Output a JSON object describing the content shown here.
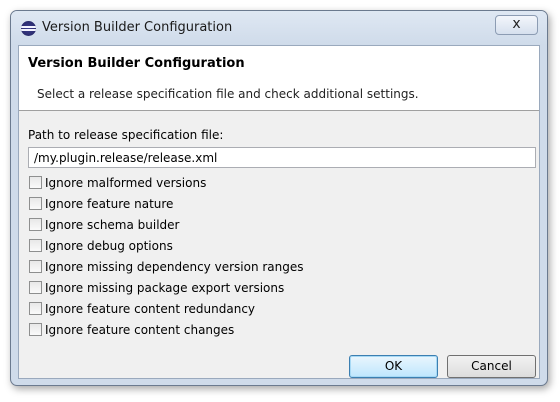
{
  "window": {
    "title": "Version Builder Configuration",
    "close_glyph": "x"
  },
  "header": {
    "title": "Version Builder Configuration",
    "description": "Select a release specification file and check additional settings."
  },
  "path": {
    "label": "Path to release specification file:",
    "value": "/my.plugin.release/release.xml"
  },
  "options": [
    {
      "label": "Ignore malformed versions",
      "checked": false
    },
    {
      "label": "Ignore feature nature",
      "checked": false
    },
    {
      "label": "Ignore schema builder",
      "checked": false
    },
    {
      "label": "Ignore debug options",
      "checked": false
    },
    {
      "label": "Ignore missing dependency version ranges",
      "checked": false
    },
    {
      "label": "Ignore missing package export versions",
      "checked": false
    },
    {
      "label": "Ignore feature content redundancy",
      "checked": false
    },
    {
      "label": "Ignore feature content changes",
      "checked": false
    }
  ],
  "buttons": {
    "ok": "OK",
    "cancel": "Cancel"
  }
}
